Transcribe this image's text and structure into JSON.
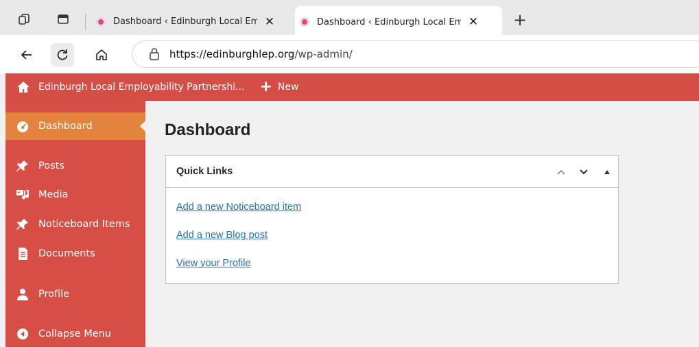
{
  "browser": {
    "tabs": [
      {
        "title": "Dashboard ‹ Edinburgh Local Emp",
        "close": "✕",
        "active": false
      },
      {
        "title": "Dashboard ‹ Edinburgh Local Emp",
        "close": "✕",
        "active": true
      }
    ],
    "new_tab": "+",
    "url_domain": "https://edinburghlep.org",
    "url_path": "/wp-admin/"
  },
  "adminbar": {
    "site_name": "Edinburgh Local Employability Partnershi...",
    "new_label": "New",
    "color": "#d54e46"
  },
  "sidebar": {
    "items": [
      {
        "label": "Dashboard",
        "icon": "dashboard-icon",
        "current": true
      },
      {
        "label": "Posts",
        "icon": "pin-icon"
      },
      {
        "label": "Media",
        "icon": "media-icon"
      },
      {
        "label": "Noticeboard Items",
        "icon": "pin-icon"
      },
      {
        "label": "Documents",
        "icon": "document-icon"
      },
      {
        "label": "Profile",
        "icon": "user-icon"
      },
      {
        "label": "Collapse Menu",
        "icon": "collapse-icon"
      }
    ],
    "color": "#d64e44",
    "current_color": "#e2843d"
  },
  "main": {
    "title": "Dashboard",
    "widget": {
      "title": "Quick Links",
      "links": [
        "Add a new Noticeboard item",
        "Add a new Blog post",
        "View your Profile"
      ]
    }
  }
}
